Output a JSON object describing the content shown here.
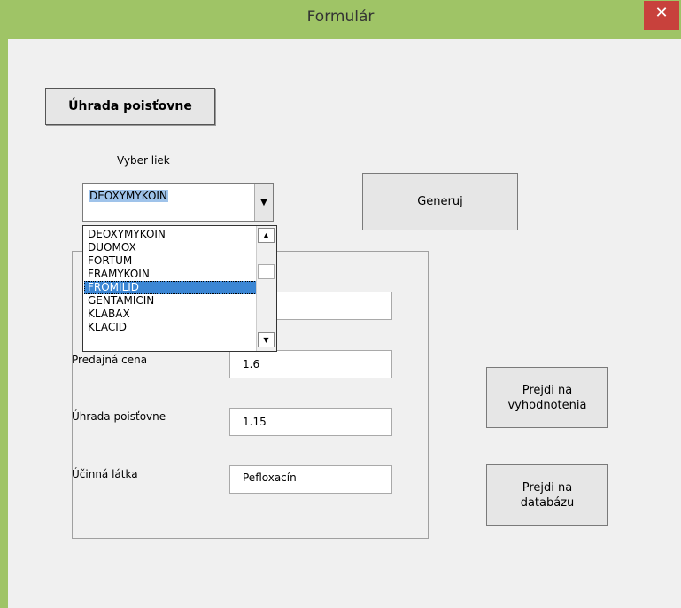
{
  "window": {
    "title": "Formulár",
    "close_glyph": "✕"
  },
  "header_button": "Úhrada poisťovne",
  "select_label": "Vyber liek",
  "combo": {
    "value": "DEOXYMYKOIN",
    "arrow": "▼"
  },
  "dropdown": {
    "items": [
      "DEOXYMYKOIN",
      "DUOMOX",
      "FORTUM",
      "FRAMYKOIN",
      "FROMILID",
      "GENTAMICIN",
      "KLABAX",
      "KLACID"
    ],
    "selected": "FROMILID",
    "up_arrow": "▲",
    "down_arrow": "▼"
  },
  "generate_button": "Generuj",
  "fields": [
    {
      "label": "",
      "value": ""
    },
    {
      "label": "Predajná cena",
      "value": "1.6"
    },
    {
      "label": "Úhrada poisťovne",
      "value": "1.15"
    },
    {
      "label": "Účinná látka",
      "value": "Pefloxacín"
    }
  ],
  "evaluations_button": [
    "Prejdi na",
    "vyhodnotenia"
  ],
  "database_button": [
    "Prejdi na",
    "databázu"
  ],
  "colors": {
    "title_bar": "#9fc466",
    "close": "#c8413c",
    "selection": "#3b86d4"
  }
}
